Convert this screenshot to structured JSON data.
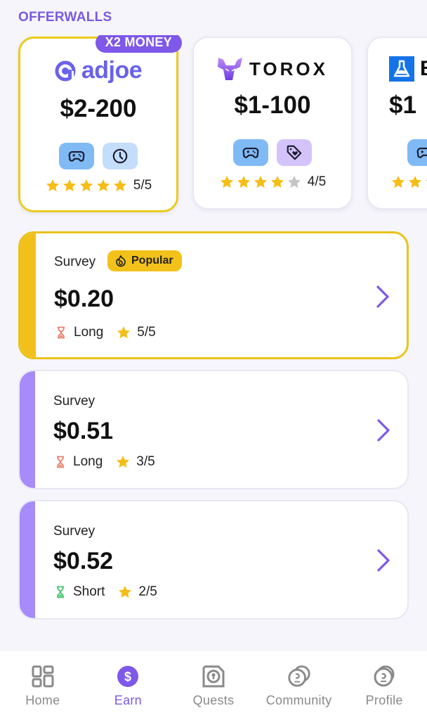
{
  "section_title": "OFFERWALLS",
  "offerwalls": [
    {
      "name": "adjoe",
      "badge": "X2 MONEY",
      "range": "$2-200",
      "tags": [
        "gamepad-icon",
        "clock-icon"
      ],
      "rating": 5,
      "rating_text": "5/5",
      "featured": true
    },
    {
      "name": "TOROX",
      "range": "$1-100",
      "tags": [
        "gamepad-icon",
        "tag-heart-icon"
      ],
      "rating": 4,
      "rating_text": "4/5"
    },
    {
      "name": "B",
      "range": "$1",
      "tags": [
        "gamepad-icon"
      ],
      "rating": 2,
      "rating_text": ""
    }
  ],
  "surveys": [
    {
      "label": "Survey",
      "badge": "Popular",
      "amount": "$0.20",
      "length": "Long",
      "rating_text": "5/5",
      "accent": "#f2c01b",
      "length_color": "#e8806a"
    },
    {
      "label": "Survey",
      "amount": "$0.51",
      "length": "Long",
      "rating_text": "3/5",
      "accent": "#a78bfa",
      "length_color": "#e8806a"
    },
    {
      "label": "Survey",
      "amount": "$0.52",
      "length": "Short",
      "rating_text": "2/5",
      "accent": "#a78bfa",
      "length_color": "#3ec46a"
    }
  ],
  "nav": [
    {
      "label": "Home",
      "icon": "home-grid-icon"
    },
    {
      "label": "Earn",
      "icon": "dollar-coin-icon",
      "active": true
    },
    {
      "label": "Quests",
      "icon": "quests-lock-icon"
    },
    {
      "label": "Community",
      "icon": "community-coins-icon"
    },
    {
      "label": "Profile",
      "icon": "profile-coin-icon"
    }
  ],
  "colors": {
    "brand": "#7e58e8",
    "gold": "#f2c01b",
    "star": "#f5bd16",
    "star_empty": "#c4c4c4"
  }
}
